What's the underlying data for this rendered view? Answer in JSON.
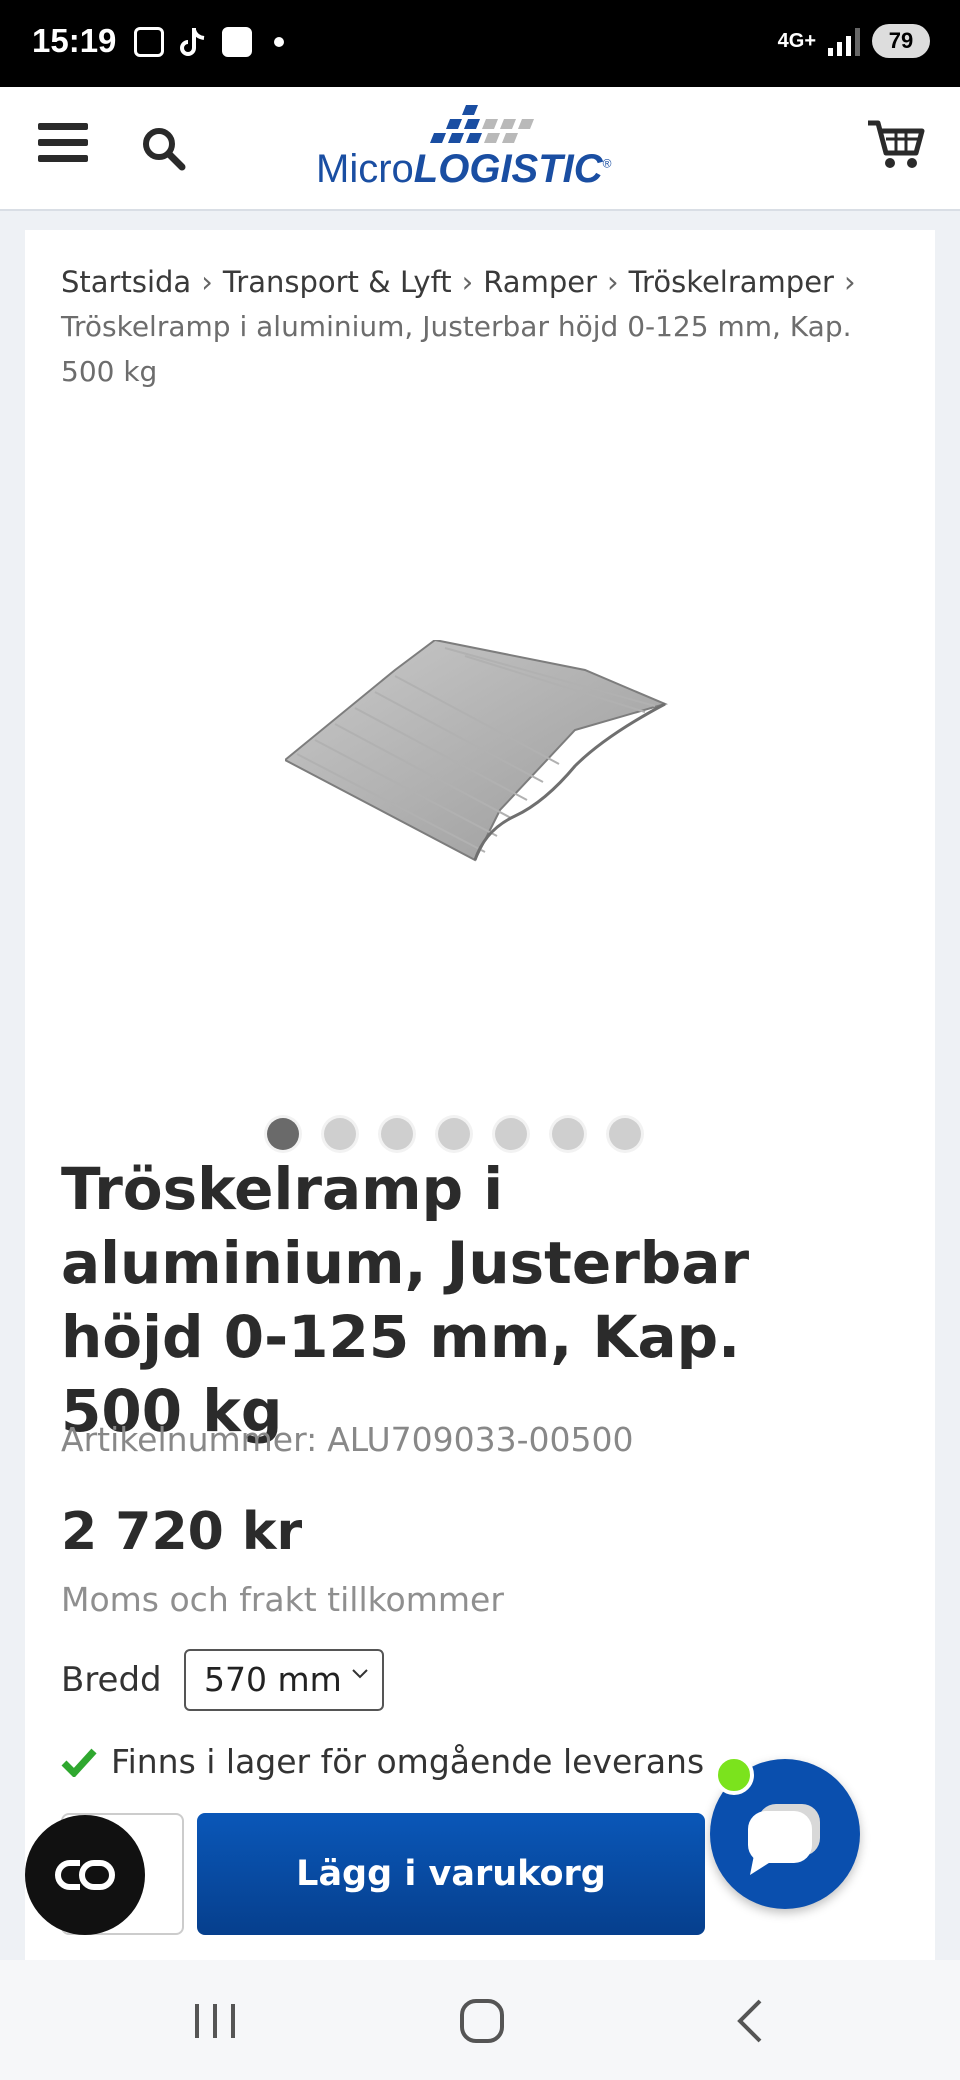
{
  "status_bar": {
    "time": "15:19",
    "network": "4G+",
    "battery": "79"
  },
  "header": {
    "logo": "MicroLOGISTIC",
    "logo_parts": {
      "light": "Micro",
      "bold": "LOGISTIC",
      "mark": "®"
    },
    "brand_color": "#1a4ea2",
    "icons": [
      "menu-icon",
      "search-icon",
      "cart-icon"
    ]
  },
  "breadcrumb": {
    "items": [
      "Startsida",
      "Transport & Lyft",
      "Ramper",
      "Tröskelramper"
    ],
    "separator": "›",
    "current": "Tröskelramp i aluminium, Justerbar höjd 0-125 mm, Kap. 500 kg"
  },
  "gallery": {
    "image_count": 7,
    "active_index": 0
  },
  "product": {
    "title": "Tröskelramp i aluminium, Justerbar höjd 0-125 mm, Kap. 500 kg",
    "sku_label": "Artikelnummer:",
    "sku": "ALU709033-00500",
    "price": "2 720 kr",
    "tax_note": "Moms och frakt tillkommer",
    "variant_label": "Bredd",
    "variant_value": "570 mm",
    "stock": "Finns i lager för omgående leverans",
    "stock_color": "#2fa82f",
    "add_to_cart": "Lägg i varukorg",
    "button_color": "#0a57b8"
  },
  "floating": {
    "left_button_text": "CO",
    "chat_online_color": "#7be31d"
  },
  "nav_bar": {
    "icons": [
      "recent-apps-icon",
      "home-icon",
      "back-icon"
    ]
  }
}
